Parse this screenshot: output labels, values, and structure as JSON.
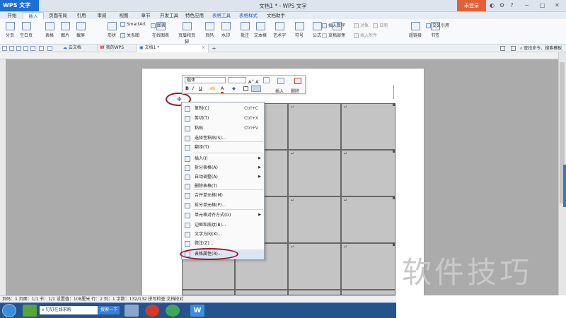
{
  "app": {
    "logo": "WPS 文字",
    "window_title": "文档1 * - WPS 文字",
    "login_button": "未登录"
  },
  "menu_tabs": [
    "开始",
    "插入",
    "页面布局",
    "引用",
    "审阅",
    "视图",
    "章节",
    "开发工具",
    "特色应用",
    "表格工具",
    "表格样式",
    "文档助手"
  ],
  "active_tab": "插入",
  "ribbon": {
    "big_buttons": [
      "分页",
      "空白页",
      "表格",
      "图片",
      "截屏",
      "形状",
      "在线图表",
      "页眉和页脚",
      "页码",
      "水印",
      "批注",
      "文本框",
      "艺术字",
      "符号",
      "公式",
      "文档部件",
      "超链接",
      "书签"
    ],
    "small_buttons": [
      "SmartArt",
      "图表",
      "关系图",
      "插入数字",
      "对象",
      "日期",
      "首字下沉",
      "插入附件",
      "交叉引用"
    ]
  },
  "doc_tabs": [
    "云文档",
    "我的WPS",
    "文档1 *"
  ],
  "search_placeholder": "查找命令、搜索模板",
  "float_toolbar": {
    "font": "楷体",
    "insert_label": "插入",
    "delete_label": "删除"
  },
  "context_menu": {
    "items": [
      {
        "label": "复制(C)",
        "shortcut": "Ctrl+C"
      },
      {
        "label": "剪切(T)",
        "shortcut": "Ctrl+X"
      },
      {
        "label": "粘贴",
        "shortcut": "Ctrl+V"
      },
      {
        "label": "选择性粘贴(S)..."
      },
      {
        "label": "翻译(T)"
      },
      {
        "label": "插入(I)",
        "submenu": true
      },
      {
        "label": "拆分表格(A)",
        "submenu": true
      },
      {
        "label": "自动调整(A)",
        "submenu": true
      },
      {
        "label": "删除表格(T)"
      },
      {
        "label": "合并单元格(M)"
      },
      {
        "label": "拆分单元格(P)..."
      },
      {
        "label": "单元格对齐方式(G)",
        "submenu": true
      },
      {
        "label": "边框和底纹(B)..."
      },
      {
        "label": "文字方向(X)..."
      },
      {
        "label": "题注(Z)..."
      },
      {
        "label": "表格属性(R)..."
      }
    ]
  },
  "status_bar": "页码：1  页面：1/1  节：1/1  设置值：108厘米  行：2  列：1  字数：132/132  拼写检查  文档校对",
  "taskbar": {
    "search_placeholder": "钉钉在线求购",
    "search_button": "搜索一下"
  },
  "watermark": "软件技巧",
  "cell_mark": "↵"
}
